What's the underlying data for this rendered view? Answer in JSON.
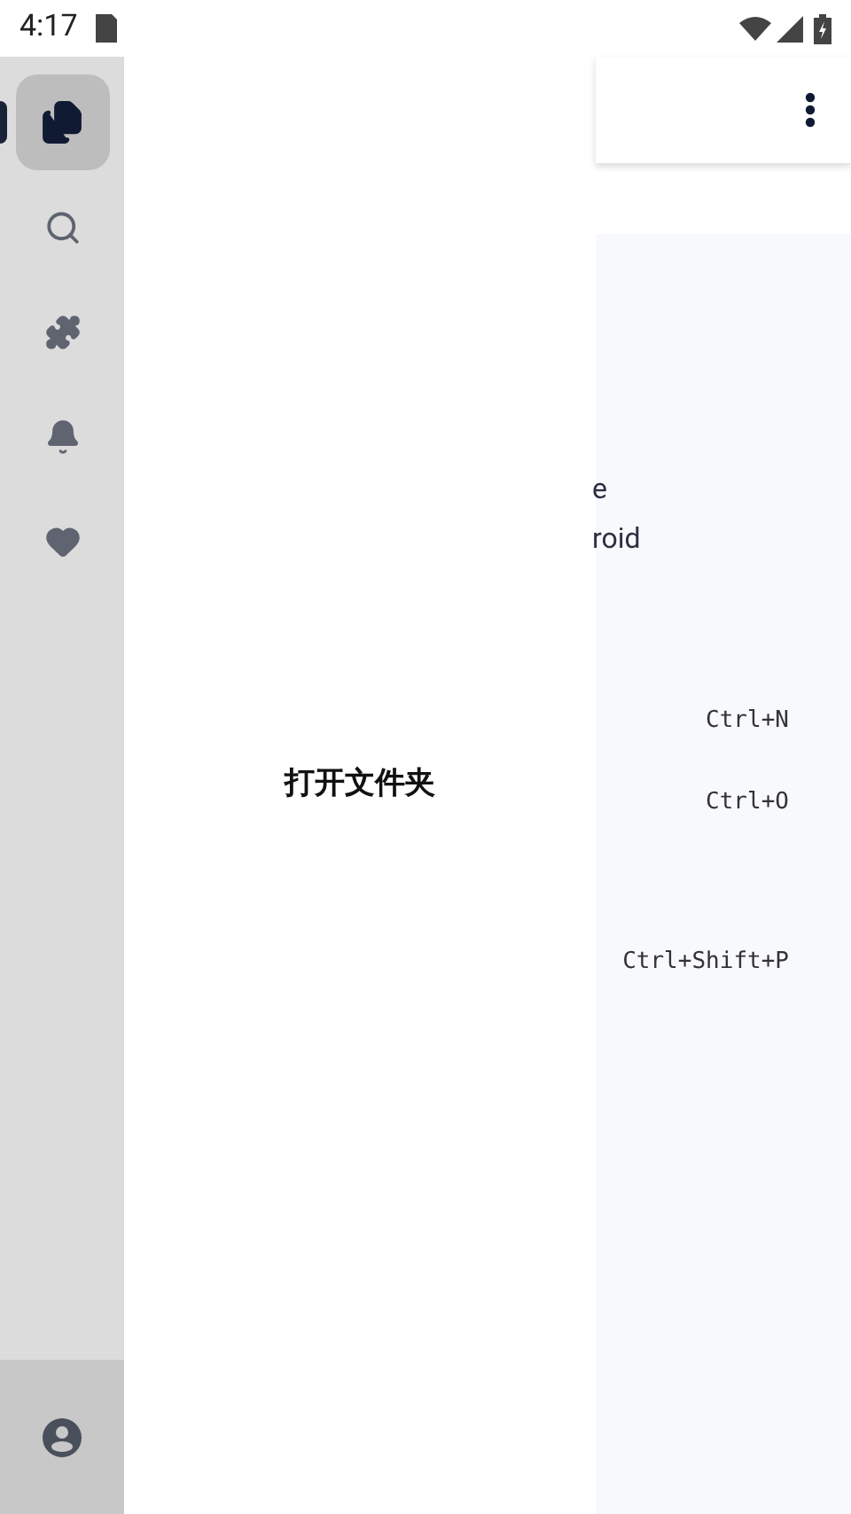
{
  "status_bar": {
    "time": "4:17"
  },
  "rail": {
    "items": [
      {
        "kind": "files",
        "selected": true
      },
      {
        "kind": "search",
        "selected": false
      },
      {
        "kind": "extensions",
        "selected": false
      },
      {
        "kind": "notifications",
        "selected": false
      },
      {
        "kind": "favorites",
        "selected": false
      }
    ]
  },
  "drawer": {
    "label": "打开文件夹"
  },
  "background": {
    "lines": [
      "e",
      "roid"
    ],
    "shortcuts": [
      "Ctrl+N",
      "Ctrl+O",
      "Ctrl+Shift+P"
    ]
  }
}
